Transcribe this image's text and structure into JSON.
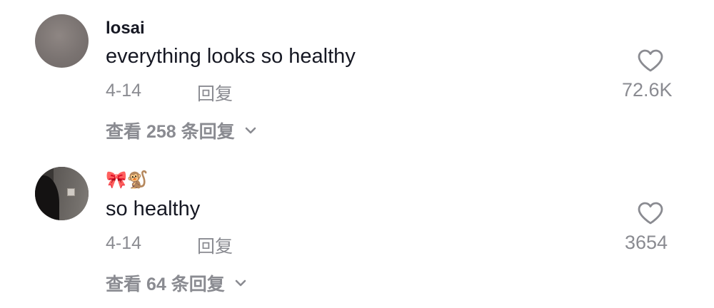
{
  "comments": [
    {
      "username": "losai",
      "text": "everything looks so healthy",
      "date": "4-14",
      "reply_label": "回复",
      "view_replies_label": "查看 258 条回复",
      "like_count": "72.6K"
    },
    {
      "username": "🎀🐒",
      "text": "so healthy",
      "date": "4-14",
      "reply_label": "回复",
      "view_replies_label": "查看 64 条回复",
      "like_count": "3654"
    }
  ],
  "icons": {
    "like": "heart-icon",
    "expand": "chevron-down-icon"
  },
  "colors": {
    "primary_text": "#161823",
    "secondary_text": "#8a8b91",
    "background": "#ffffff"
  }
}
